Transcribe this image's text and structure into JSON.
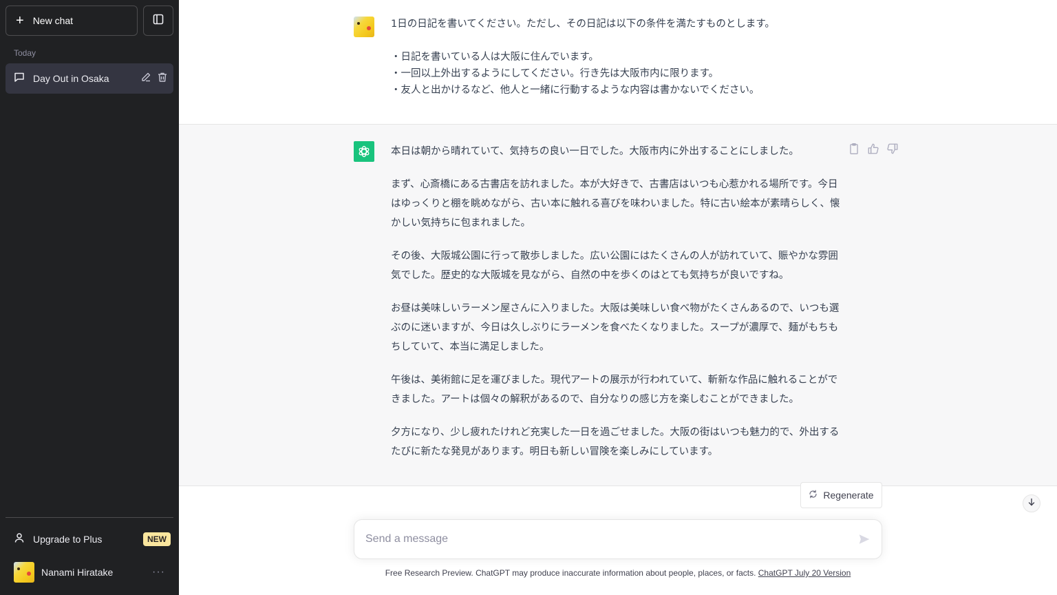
{
  "sidebar": {
    "new_chat_label": "New chat",
    "section_label": "Today",
    "chats": [
      {
        "title": "Day Out in Osaka",
        "active": true
      }
    ],
    "upgrade_label": "Upgrade to Plus",
    "upgrade_badge": "NEW",
    "user_name": "Nanami Hiratake",
    "more_label": "···"
  },
  "conversation": {
    "user_message": {
      "intro": "1日の日記を書いてください。ただし、その日記は以下の条件を満たすものとします。",
      "conditions": [
        "・日記を書いている人は大阪に住んでいます。",
        "・一回以上外出するようにしてください。行き先は大阪市内に限ります。",
        "・友人と出かけるなど、他人と一緒に行動するような内容は書かないでください。"
      ]
    },
    "assistant_message": {
      "paragraphs": [
        "本日は朝から晴れていて、気持ちの良い一日でした。大阪市内に外出することにしました。",
        "まず、心斎橋にある古書店を訪れました。本が大好きで、古書店はいつも心惹かれる場所です。今日はゆっくりと棚を眺めながら、古い本に触れる喜びを味わいました。特に古い絵本が素晴らしく、懐かしい気持ちに包まれました。",
        "その後、大阪城公園に行って散歩しました。広い公園にはたくさんの人が訪れていて、賑やかな雰囲気でした。歴史的な大阪城を見ながら、自然の中を歩くのはとても気持ちが良いですね。",
        "お昼は美味しいラーメン屋さんに入りました。大阪は美味しい食べ物がたくさんあるので、いつも選ぶのに迷いますが、今日は久しぶりにラーメンを食べたくなりました。スープが濃厚で、麺がもちもちしていて、本当に満足しました。",
        "午後は、美術館に足を運びました。現代アートの展示が行われていて、斬新な作品に触れることができました。アートは個々の解釈があるので、自分なりの感じ方を楽しむことができました。",
        "夕方になり、少し疲れたけれど充実した一日を過ごせました。大阪の街はいつも魅力的で、外出するたびに新たな発見があります。明日も新しい冒険を楽しみにしています。"
      ]
    }
  },
  "composer": {
    "regenerate_label": "Regenerate",
    "placeholder": "Send a message",
    "value": ""
  },
  "footer": {
    "disclaimer": "Free Research Preview. ChatGPT may produce inaccurate information about people, places, or facts. ",
    "version_link": "ChatGPT July 20 Version"
  },
  "colors": {
    "sidebar_bg": "#202123",
    "active_chat_bg": "#343541",
    "assistant_bg": "#f7f7f8",
    "brand_green": "#19c37d",
    "badge_bg": "#fae69e"
  }
}
